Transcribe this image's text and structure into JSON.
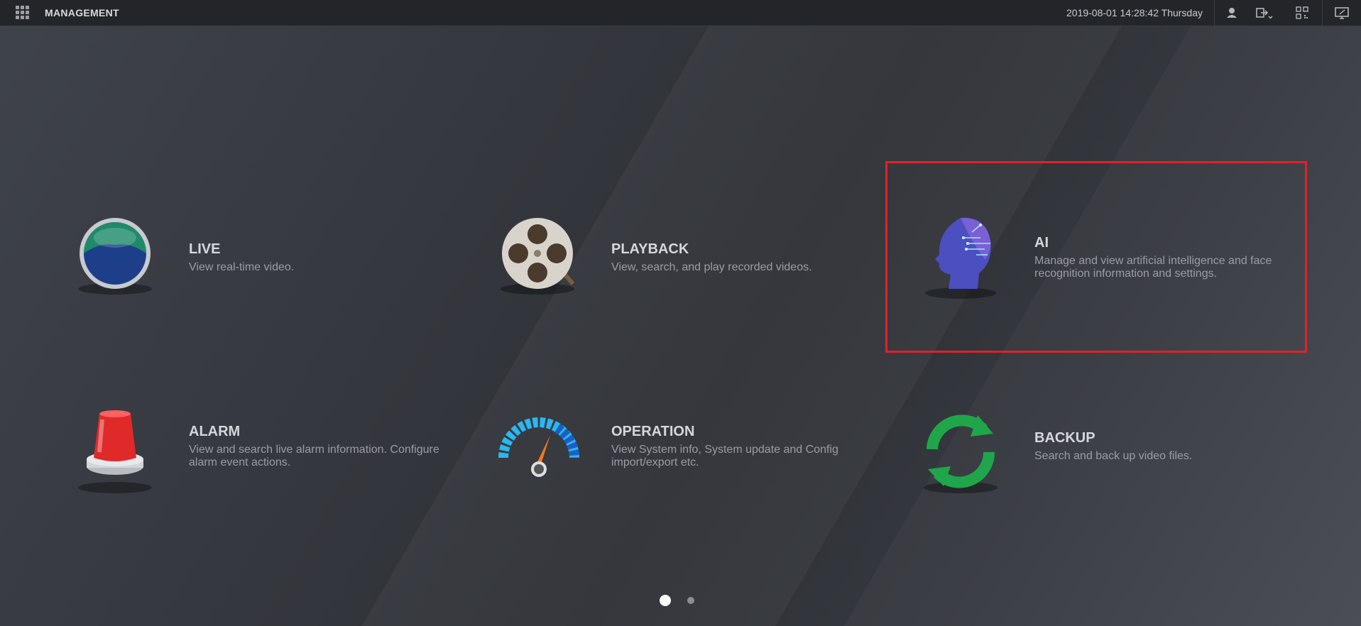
{
  "topbar": {
    "title": "MANAGEMENT",
    "datetime": "2019-08-01 14:28:42 Thursday"
  },
  "tiles": [
    {
      "title": "LIVE",
      "desc": "View real-time video.",
      "icon": "live-globe-icon"
    },
    {
      "title": "PLAYBACK",
      "desc": "View, search, and play recorded videos.",
      "icon": "film-reel-icon"
    },
    {
      "title": "AI",
      "desc": "Manage and view artificial intelligence and face recognition information and settings.",
      "icon": "ai-head-icon"
    },
    {
      "title": "ALARM",
      "desc": "View and search live alarm information. Configure alarm event actions.",
      "icon": "alarm-siren-icon"
    },
    {
      "title": "OPERATION",
      "desc": "View System info, System update and Config import/export etc.",
      "icon": "speedometer-icon"
    },
    {
      "title": "BACKUP",
      "desc": "Search and back up video files.",
      "icon": "backup-sync-icon"
    }
  ],
  "highlighted_tile": "AI",
  "pagination": {
    "current": 1,
    "total": 2
  },
  "colors": {
    "highlight": "#e0212b",
    "topbar": "#232529"
  }
}
